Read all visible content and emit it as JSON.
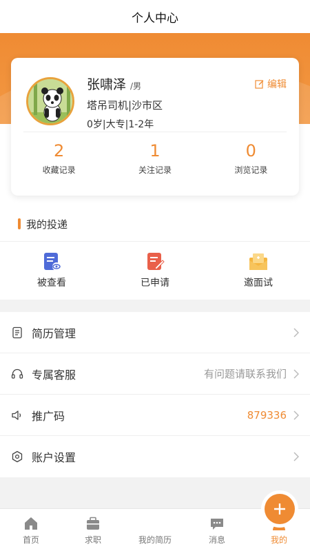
{
  "header": {
    "title": "个人中心"
  },
  "profile": {
    "name": "张啸泽",
    "gender": "/男",
    "edit_label": "编辑",
    "job_location": "塔吊司机|沙市区",
    "meta": "0岁|大专|1-2年",
    "stats": [
      {
        "value": "2",
        "label": "收藏记录"
      },
      {
        "value": "1",
        "label": "关注记录"
      },
      {
        "value": "0",
        "label": "浏览记录"
      }
    ]
  },
  "delivery": {
    "title": "我的投递",
    "items": [
      {
        "label": "被查看",
        "icon": "viewed-doc-icon"
      },
      {
        "label": "已申请",
        "icon": "applied-edit-icon"
      },
      {
        "label": "邀面试",
        "icon": "interview-mail-icon"
      }
    ]
  },
  "menu": [
    {
      "label": "简历管理",
      "value": "",
      "icon": "resume-icon"
    },
    {
      "label": "专属客服",
      "value": "有问题请联系我们",
      "icon": "headset-icon"
    },
    {
      "label": "推广码",
      "value": "879336",
      "icon": "speaker-icon"
    },
    {
      "label": "账户设置",
      "value": "",
      "icon": "settings-icon"
    }
  ],
  "tabbar": [
    {
      "label": "首页",
      "icon": "home-icon"
    },
    {
      "label": "求职",
      "icon": "briefcase-icon"
    },
    {
      "label": "我的简历",
      "icon": "plus-icon"
    },
    {
      "label": "消息",
      "icon": "message-icon"
    },
    {
      "label": "我的",
      "icon": "user-icon",
      "active": true
    }
  ],
  "colors": {
    "accent": "#ef8b33",
    "blue": "#4f6bd8",
    "red": "#e9604a",
    "yellow": "#f5b640"
  }
}
